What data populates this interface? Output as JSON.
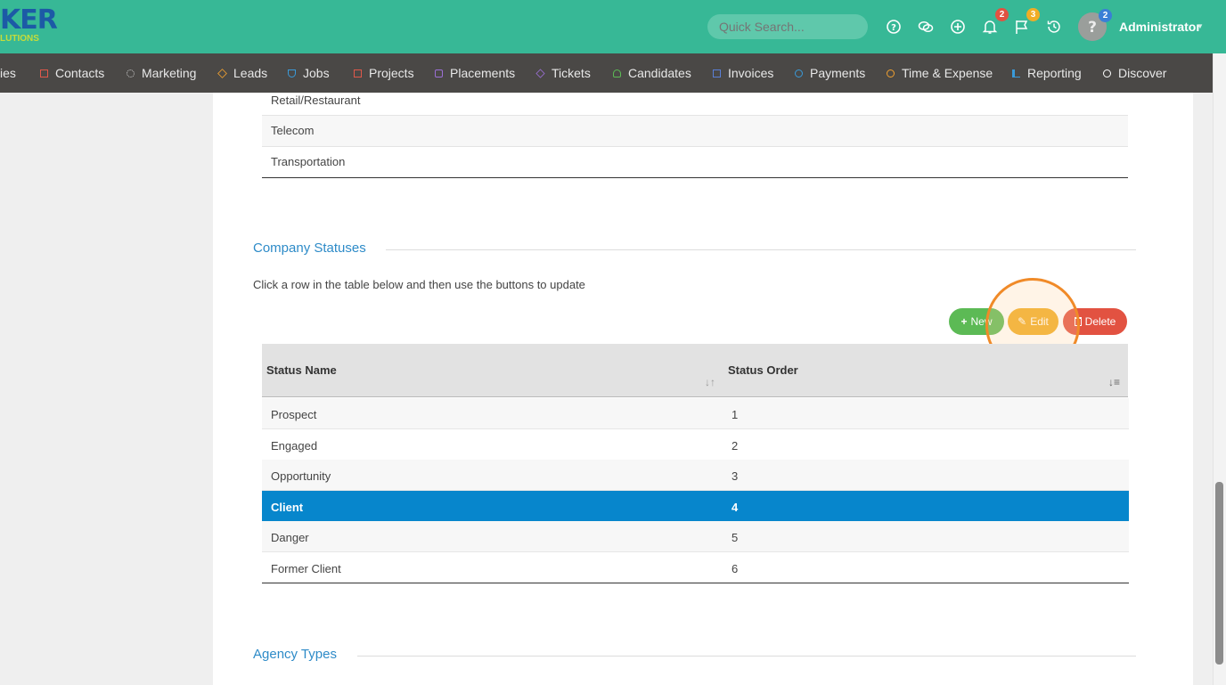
{
  "header": {
    "logo_text": "KER",
    "logo_subtext": "LUTIONS",
    "search_placeholder": "Quick Search...",
    "notifications_count": "2",
    "flags_count": "3",
    "avatar_badge": "2",
    "user_name": "Administrator",
    "colors": {
      "topbar": "#37b896",
      "navbar": "#4a4846"
    }
  },
  "nav": {
    "items": [
      {
        "label": "ies",
        "icon": "building-icon"
      },
      {
        "label": "Contacts",
        "icon": "contact-card-icon",
        "color": "#e0584a"
      },
      {
        "label": "Marketing",
        "icon": "broadcast-icon",
        "color": "#cfcfcf"
      },
      {
        "label": "Leads",
        "icon": "diamond-icon",
        "color": "#f0a030"
      },
      {
        "label": "Jobs",
        "icon": "trophy-icon",
        "color": "#3a9ad9"
      },
      {
        "label": "Projects",
        "icon": "project-icon",
        "color": "#e0584a"
      },
      {
        "label": "Placements",
        "icon": "briefcase-icon",
        "color": "#9b6fd6"
      },
      {
        "label": "Tickets",
        "icon": "tag-icon",
        "color": "#9b6fd6"
      },
      {
        "label": "Candidates",
        "icon": "person-icon",
        "color": "#5cba55"
      },
      {
        "label": "Invoices",
        "icon": "invoice-icon",
        "color": "#5a7fd6"
      },
      {
        "label": "Payments",
        "icon": "coin-icon",
        "color": "#3a9ad9"
      },
      {
        "label": "Time & Expense",
        "icon": "clock-icon",
        "color": "#f0a030"
      },
      {
        "label": "Reporting",
        "icon": "bar-chart-icon",
        "color": "#3a9ad9"
      },
      {
        "label": "Discover",
        "icon": "search-icon",
        "color": "#ffffff"
      }
    ]
  },
  "industries_table": {
    "rows": [
      "Retail/Restaurant",
      "Telecom",
      "Transportation"
    ]
  },
  "company_statuses": {
    "title": "Company Statuses",
    "hint": "Click a row in the table below and then use the buttons to update",
    "buttons": {
      "new": "New",
      "edit": "Edit",
      "delete": "Delete"
    },
    "columns": [
      "Status Name",
      "Status Order"
    ],
    "rows": [
      {
        "name": "Prospect",
        "order": "1"
      },
      {
        "name": "Engaged",
        "order": "2"
      },
      {
        "name": "Opportunity",
        "order": "3"
      },
      {
        "name": "Client",
        "order": "4",
        "selected": true
      },
      {
        "name": "Danger",
        "order": "5"
      },
      {
        "name": "Former Client",
        "order": "6"
      }
    ]
  },
  "agency_types": {
    "title": "Agency Types"
  }
}
